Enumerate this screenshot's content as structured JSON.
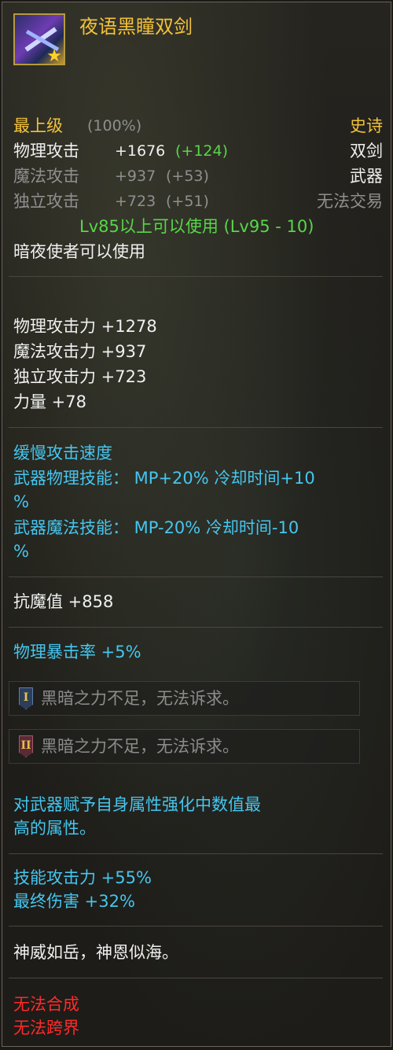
{
  "item": {
    "name": "夜语黑瞳双剑",
    "icon": "twin-swords-icon",
    "grade": "最上级",
    "grade_pct": "(100%)",
    "rarity": "史诗",
    "type": "双剑",
    "category": "武器",
    "trade": "无法交易"
  },
  "base_stats": [
    {
      "label": "物理攻击",
      "value": "+1676",
      "bonus": "(+124)"
    },
    {
      "label": "魔法攻击",
      "value": "+937",
      "bonus": "(+53)"
    },
    {
      "label": "独立攻击",
      "value": "+723",
      "bonus": "(+51)"
    }
  ],
  "requirement": {
    "level": "Lv85以上可以使用 (Lv95 - 10)",
    "class": "暗夜使者可以使用"
  },
  "attributes": [
    "物理攻击力 +1278",
    "魔法攻击力 +937",
    "独立攻击力 +723",
    "力量 +78"
  ],
  "speed": {
    "line1": "缓慢攻击速度",
    "line2a": "武器物理技能： MP+20% 冷却时间+10",
    "line2b": "%",
    "line3a": "武器魔法技能： MP-20% 冷却时间-10",
    "line3b": "%"
  },
  "resist": "抗魔值 +858",
  "crit": "物理暴击率 +5%",
  "seals": [
    {
      "numeral": "I",
      "text": "黑暗之力不足，无法诉求。"
    },
    {
      "numeral": "II",
      "text": "黑暗之力不足，无法诉求。"
    }
  ],
  "enchant": {
    "line1": "对武器赋予自身属性强化中数值最",
    "line2": "高的属性。"
  },
  "bonus": {
    "line1": "技能攻击力 +55%",
    "line2": "最终伤害 +32%"
  },
  "flavor": "神威如岳，神恩似海。",
  "restrictions": [
    "无法合成",
    "无法跨界"
  ],
  "colors": {
    "gold": "#f3c23a",
    "green": "#58d64a",
    "cyan": "#45c6ef",
    "red": "#ff2a2a",
    "grey": "#8f8f8f"
  }
}
